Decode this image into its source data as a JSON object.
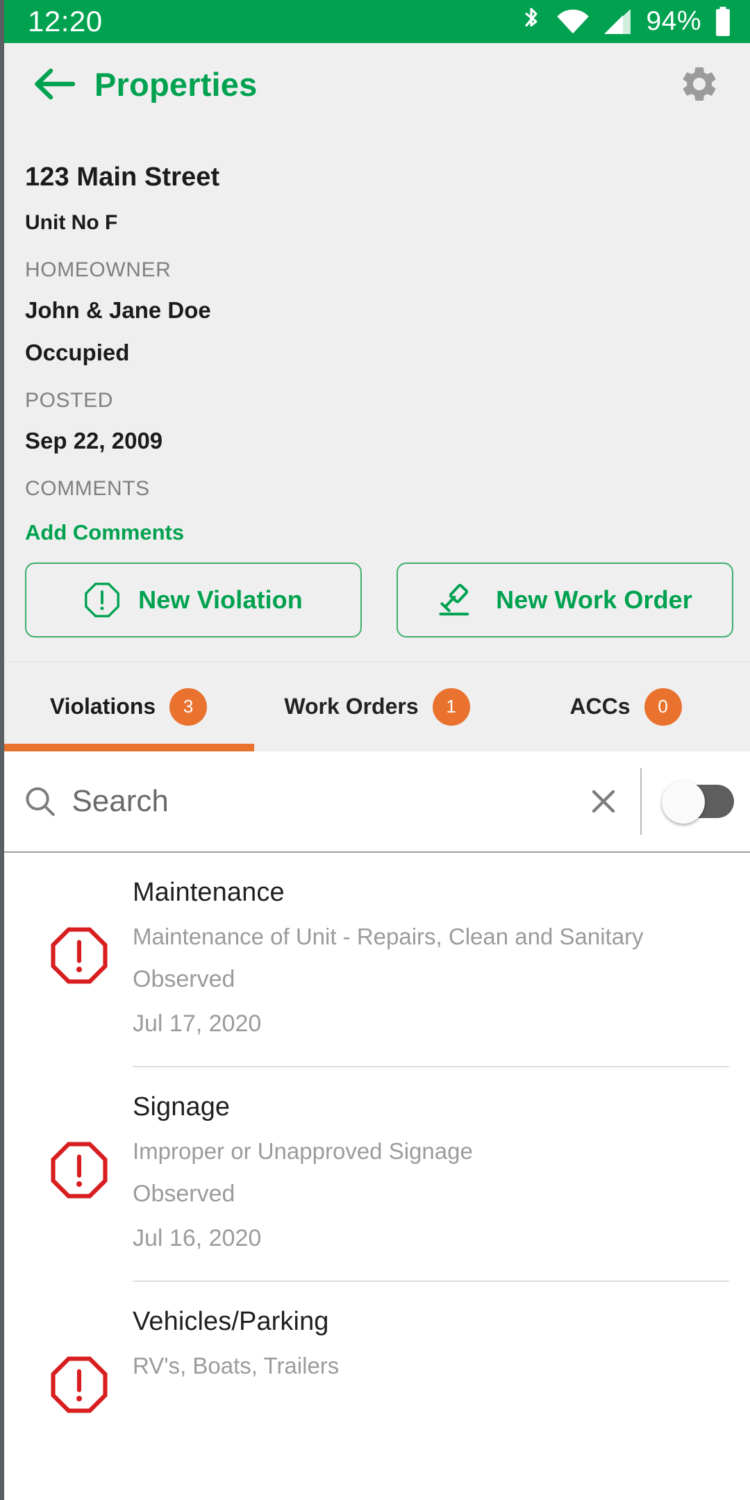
{
  "statusbar": {
    "time": "12:20",
    "battery_percent": "94%",
    "icons": [
      "bluetooth-icon",
      "wifi-icon",
      "cellular-signal-icon",
      "battery-icon"
    ],
    "background_color": "#00A250"
  },
  "appbar": {
    "back_label": "back-arrow",
    "title": "Properties",
    "settings_label": "settings",
    "title_color": "#00A250"
  },
  "details": {
    "address": "123 Main Street",
    "unit": "Unit No F",
    "homeowner_label": "HOMEOWNER",
    "homeowner": "John & Jane Doe",
    "occupancy_status": "Occupied",
    "posted_label": "POSTED",
    "posted_date": "Sep 22, 2009",
    "comments_label": "COMMENTS",
    "add_comments": "Add Comments"
  },
  "actions": {
    "new_violation": "New Violation",
    "new_work_order": "New Work Order",
    "accent_color": "#00A250"
  },
  "tabs": {
    "accent_color": "#E8722E",
    "items": [
      {
        "label": "Violations",
        "badge": "3",
        "active": true
      },
      {
        "label": "Work Orders",
        "badge": "1",
        "active": false
      },
      {
        "label": "ACCs",
        "badge": "0",
        "active": false
      }
    ]
  },
  "search": {
    "placeholder": "Search",
    "value": "",
    "clear_label": "×",
    "toggle_on": false
  },
  "list": {
    "items": [
      {
        "title": "Maintenance",
        "description": "Maintenance of Unit - Repairs, Clean and Sanitary",
        "status": "Observed",
        "date": "Jul 17, 2020",
        "icon_color": "#D81E20"
      },
      {
        "title": "Signage",
        "description": "Improper or Unapproved Signage",
        "status": "Observed",
        "date": "Jul 16, 2020",
        "icon_color": "#D81E20"
      },
      {
        "title": "Vehicles/Parking",
        "description": "RV's, Boats, Trailers",
        "status": "",
        "date": "",
        "icon_color": "#D81E20"
      }
    ]
  }
}
